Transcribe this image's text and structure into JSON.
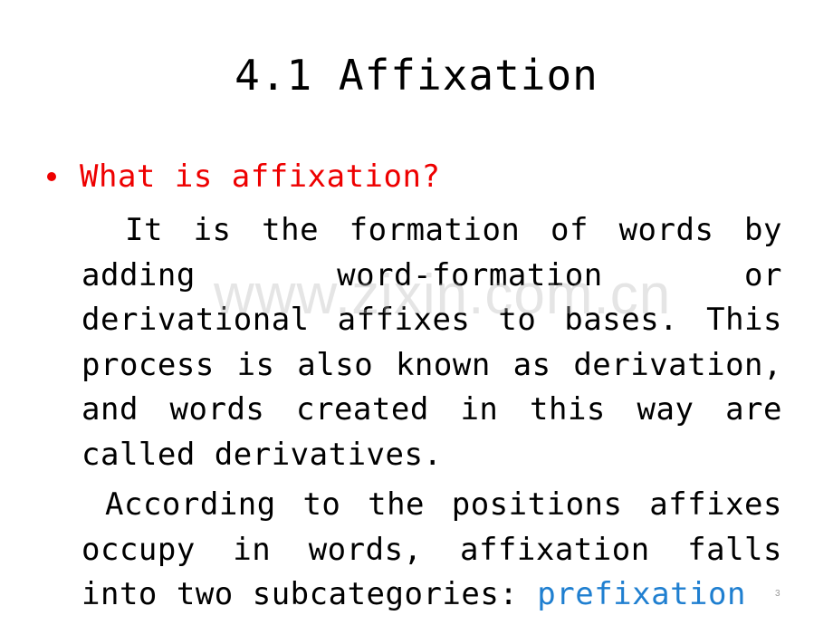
{
  "slide": {
    "title": "4.1 Affixation",
    "bullet": "What is affixation?",
    "paragraph1": "It is the formation of words by adding word-formation or derivational affixes to bases. This process is also known as derivation, and words created in this way are called derivatives.",
    "paragraph2_text": "According to the positions affixes occupy in words, affixation falls into two subcategories: ",
    "paragraph2_highlight": "prefixation",
    "page_number": "3",
    "watermark": "www.zixin.com.cn"
  },
  "colors": {
    "bullet": "#ee0000",
    "highlight": "#1f7fd0",
    "text": "#000000"
  }
}
